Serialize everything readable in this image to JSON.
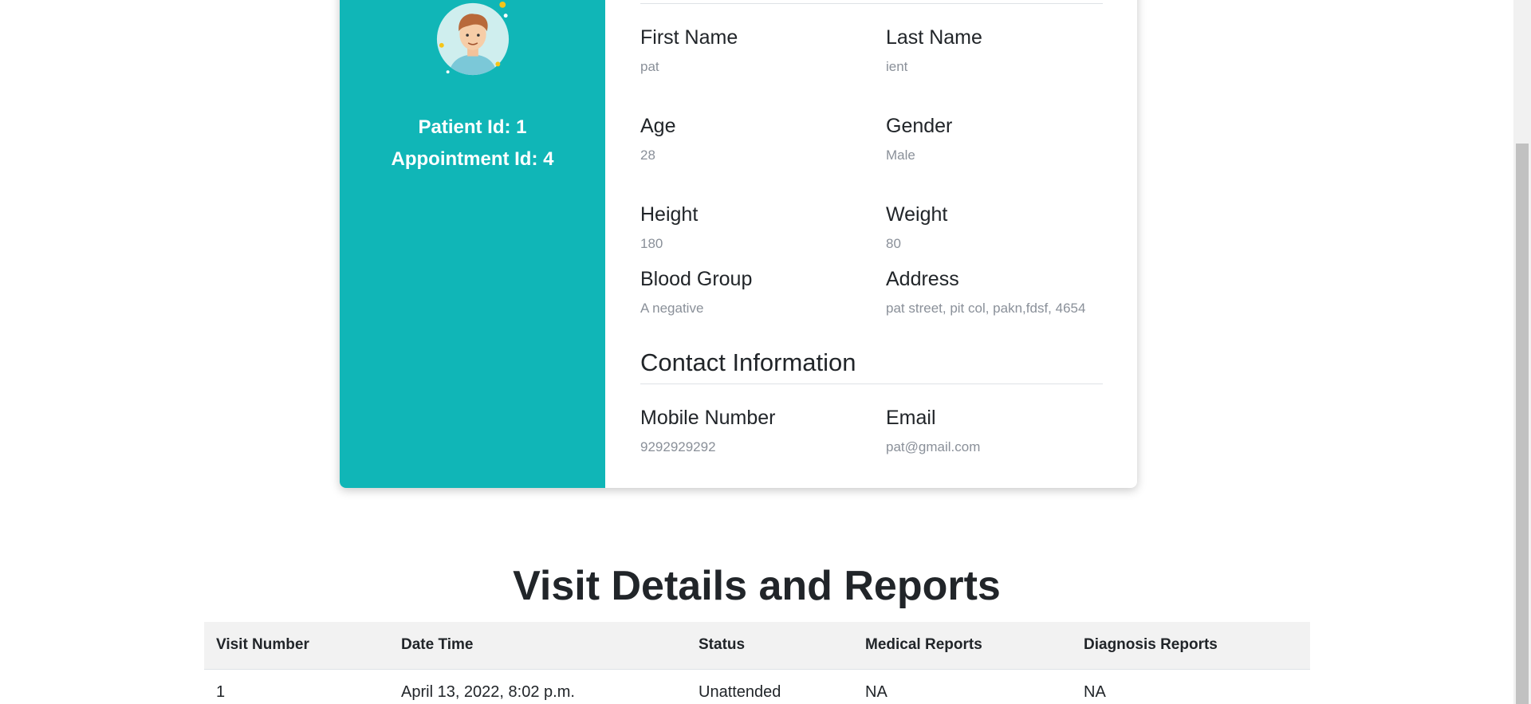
{
  "profile": {
    "patient_id_text": "Patient Id: 1",
    "appointment_id_text": "Appointment Id: 4",
    "fields": {
      "first_name": {
        "label": "First Name",
        "value": "pat"
      },
      "last_name": {
        "label": "Last Name",
        "value": "ient"
      },
      "age": {
        "label": "Age",
        "value": "28"
      },
      "gender": {
        "label": "Gender",
        "value": "Male"
      },
      "height": {
        "label": "Height",
        "value": "180"
      },
      "weight": {
        "label": "Weight",
        "value": "80"
      },
      "blood_group": {
        "label": "Blood Group",
        "value": "A negative"
      },
      "address": {
        "label": "Address",
        "value": "pat street, pit col, pakn,fdsf, 4654"
      }
    },
    "contact": {
      "title": "Contact Information",
      "mobile": {
        "label": "Mobile Number",
        "value": "9292929292"
      },
      "email": {
        "label": "Email",
        "value": "pat@gmail.com"
      }
    }
  },
  "visits": {
    "title": "Visit Details and Reports",
    "columns": [
      "Visit Number",
      "Date Time",
      "Status",
      "Medical Reports",
      "Diagnosis Reports"
    ],
    "rows": [
      [
        "1",
        "April 13, 2022, 8:02 p.m.",
        "Unattended",
        "NA",
        "NA"
      ]
    ]
  },
  "colors": {
    "accent": "#10b6b7"
  },
  "icons": {
    "avatar": "patient-avatar-icon"
  }
}
